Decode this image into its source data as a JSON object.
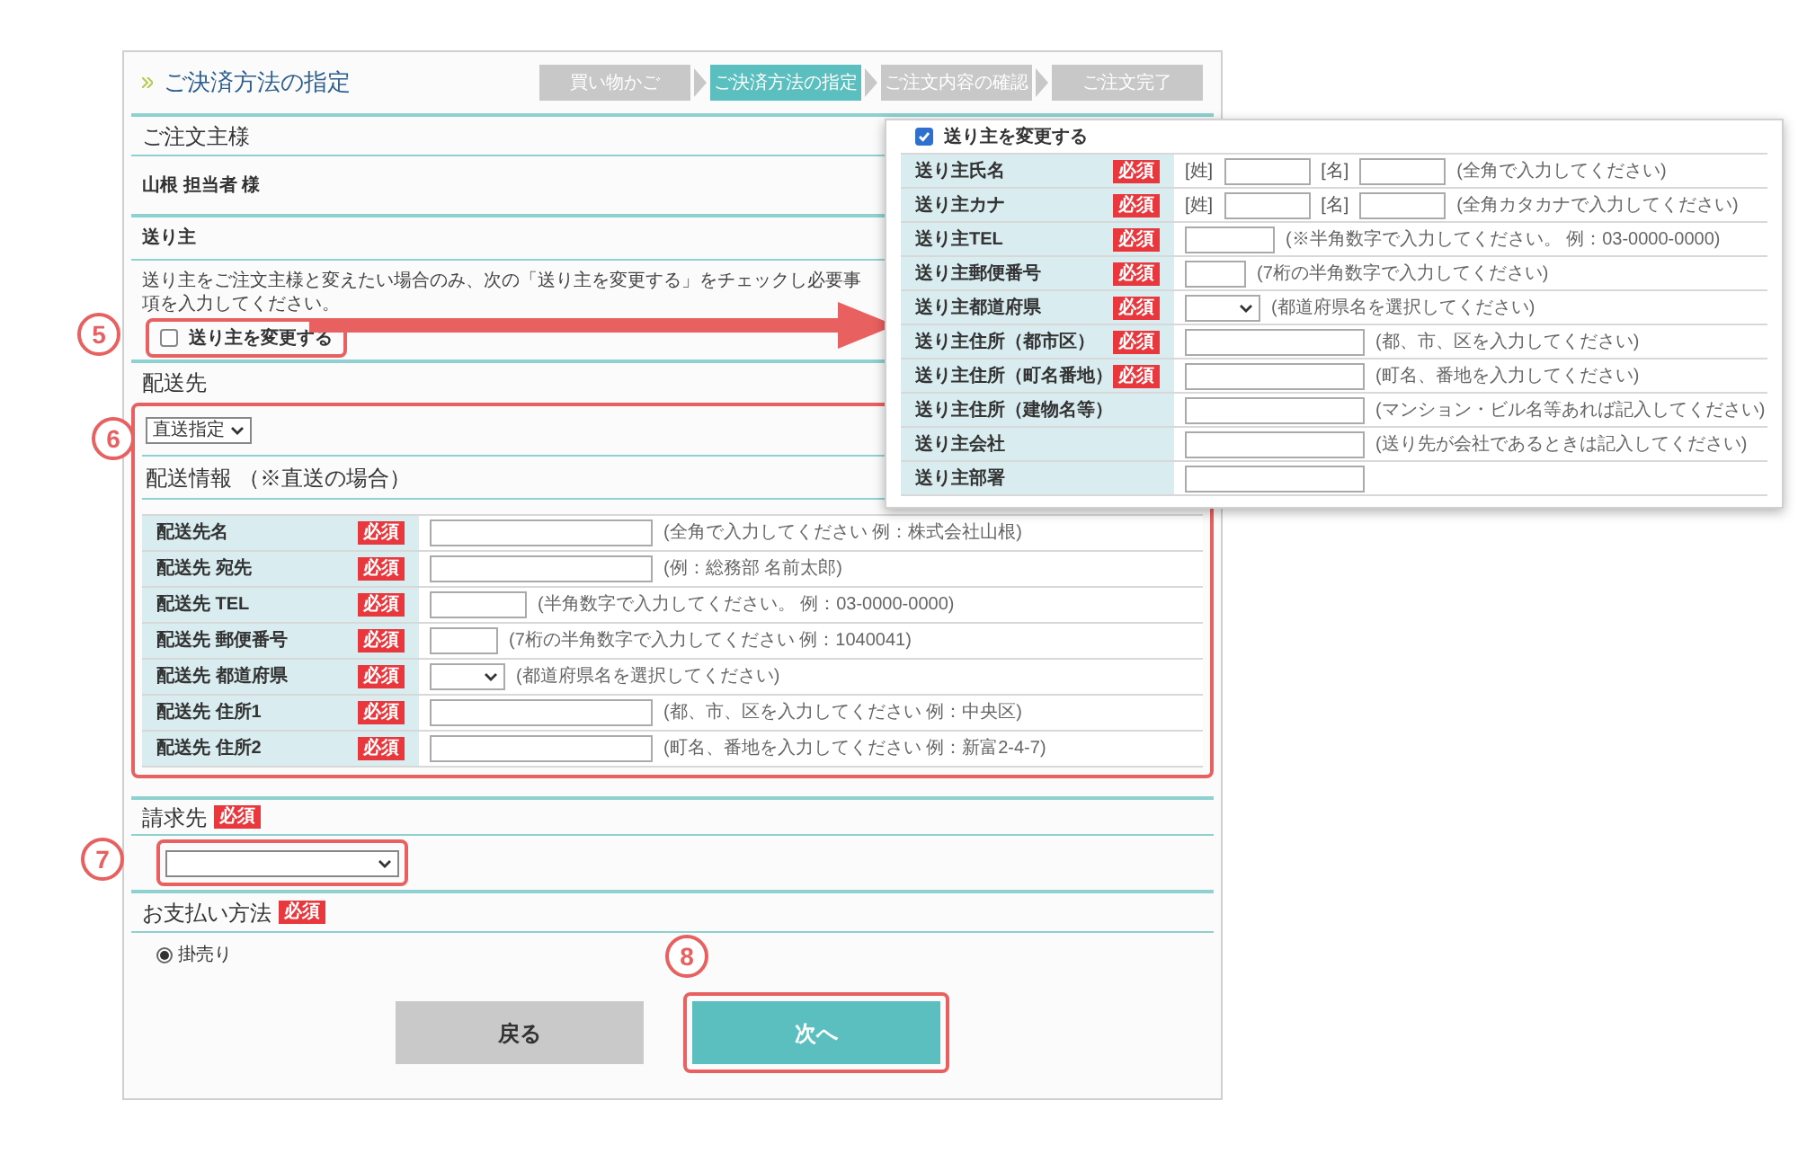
{
  "title": "ご決済方法の指定",
  "steps": [
    {
      "label": "買い物かご",
      "selected": false
    },
    {
      "label": "ご決済方法の指定",
      "selected": true
    },
    {
      "label": "ご注文内容の確認",
      "selected": false
    },
    {
      "label": "ご注文完了",
      "selected": false
    }
  ],
  "orderer": {
    "heading": "ご注文主様",
    "name": "山根 担当者 様"
  },
  "sender": {
    "heading": "送り主",
    "note": "送り主をご注文主様と変えたい場合のみ、次の「送り主を変更する」をチェックし必要事項を入力してください。",
    "change_checkbox": {
      "label": "送り主を変更する",
      "checked": false,
      "annotation": "5"
    }
  },
  "delivery": {
    "heading": "配送先",
    "annotation": "6",
    "select_value": "直送指定",
    "info_heading": "配送情報 （※直送の場合）",
    "rows": [
      {
        "label": "配送先名",
        "badge": "必須",
        "kind": "wide",
        "hint": "(全角で入力してください 例：株式会社山根)"
      },
      {
        "label": "配送先 宛先",
        "badge": "必須",
        "kind": "wide",
        "hint": "(例：総務部 名前太郎)"
      },
      {
        "label": "配送先 TEL",
        "badge": "必須",
        "kind": "medium",
        "hint": "(半角数字で入力してください。 例：03-0000-0000)"
      },
      {
        "label": "配送先 郵便番号",
        "badge": "必須",
        "kind": "short",
        "hint": "(7桁の半角数字で入力してください 例：1040041)"
      },
      {
        "label": "配送先 都道府県",
        "badge": "必須",
        "kind": "select",
        "hint": "(都道府県名を選択してください)"
      },
      {
        "label": "配送先 住所1",
        "badge": "必須",
        "kind": "wide",
        "hint": "(都、市、区を入力してください 例：中央区)"
      },
      {
        "label": "配送先 住所2",
        "badge": "必須",
        "kind": "wide",
        "hint": "(町名、番地を入力してください 例：新富2-4-7)"
      }
    ]
  },
  "billing": {
    "heading": "請求先",
    "badge": "必須",
    "annotation": "7"
  },
  "payment": {
    "heading": "お支払い方法",
    "badge": "必須",
    "options": [
      {
        "label": "掛売り",
        "selected": true
      }
    ]
  },
  "buttons": [
    {
      "label": "戻る",
      "kind": "back"
    },
    {
      "label": "次へ",
      "kind": "next",
      "annotation": "8"
    }
  ],
  "sender_popup": {
    "checkbox": {
      "label": "送り主を変更する",
      "checked": true
    },
    "rows": [
      {
        "label": "送り主氏名",
        "badge": "必須",
        "kind": "name",
        "parts": [
          {
            "label": "[姓]"
          },
          {
            "label": "[名]"
          }
        ],
        "hint": "(全角で入力してください)"
      },
      {
        "label": "送り主カナ",
        "badge": "必須",
        "kind": "name",
        "parts": [
          {
            "label": "[姓]"
          },
          {
            "label": "[名]"
          }
        ],
        "hint": "(全角カタカナで入力してください)"
      },
      {
        "label": "送り主TEL",
        "badge": "必須",
        "kind": "medium",
        "hint": "(※半角数字で入力してください。 例：03-0000-0000)"
      },
      {
        "label": "送り主郵便番号",
        "badge": "必須",
        "kind": "short",
        "hint": "(7桁の半角数字で入力してください)"
      },
      {
        "label": "送り主都道府県",
        "badge": "必須",
        "kind": "select",
        "hint": "(都道府県名を選択してください)"
      },
      {
        "label": "送り主住所（都市区）",
        "badge": "必須",
        "kind": "wide",
        "hint": "(都、市、区を入力してください)"
      },
      {
        "label": "送り主住所（町名番地）",
        "badge": "必須",
        "kind": "wide",
        "hint": "(町名、番地を入力してください)"
      },
      {
        "label": "送り主住所（建物名等）",
        "kind": "wide",
        "hint": "(マンション・ビル名等あれば記入してください)"
      },
      {
        "label": "送り主会社",
        "kind": "wide",
        "hint": "(送り先が会社であるときは記入してください)"
      },
      {
        "label": "送り主部署",
        "kind": "wide"
      }
    ]
  }
}
